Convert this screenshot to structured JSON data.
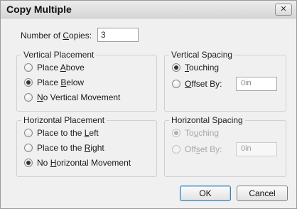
{
  "dialog": {
    "title": "Copy Multiple",
    "close_glyph": "✕"
  },
  "copies": {
    "label_pre": "Number of ",
    "label_key": "C",
    "label_post": "opies:",
    "value": "3"
  },
  "vertical_placement": {
    "title": "Vertical Placement",
    "options": [
      {
        "pre": "Place ",
        "key": "A",
        "post": "bove",
        "checked": false
      },
      {
        "pre": "Place ",
        "key": "B",
        "post": "elow",
        "checked": true
      },
      {
        "pre": "",
        "key": "N",
        "post": "o Vertical Movement",
        "checked": false
      }
    ]
  },
  "vertical_spacing": {
    "title": "Vertical Spacing",
    "touching": {
      "pre": "",
      "key": "T",
      "post": "ouching",
      "checked": true
    },
    "offset": {
      "pre": "",
      "key": "O",
      "post": "ffset By:",
      "checked": false
    },
    "offset_value": "0in"
  },
  "horizontal_placement": {
    "title": "Horizontal Placement",
    "options": [
      {
        "pre": "Place to the ",
        "key": "L",
        "post": "eft",
        "checked": false
      },
      {
        "pre": "Place to the ",
        "key": "R",
        "post": "ight",
        "checked": false
      },
      {
        "pre": "No ",
        "key": "H",
        "post": "orizontal Movement",
        "checked": true
      }
    ]
  },
  "horizontal_spacing": {
    "title": "Horizontal Spacing",
    "touching": {
      "pre": "To",
      "key": "u",
      "post": "ching",
      "checked": true
    },
    "offset": {
      "pre": "Off",
      "key": "s",
      "post": "et By:",
      "checked": false
    },
    "offset_value": "0in",
    "disabled": true
  },
  "buttons": {
    "ok": "OK",
    "cancel": "Cancel"
  },
  "icons": {
    "close": "close-icon",
    "radio": "radio-icon"
  }
}
